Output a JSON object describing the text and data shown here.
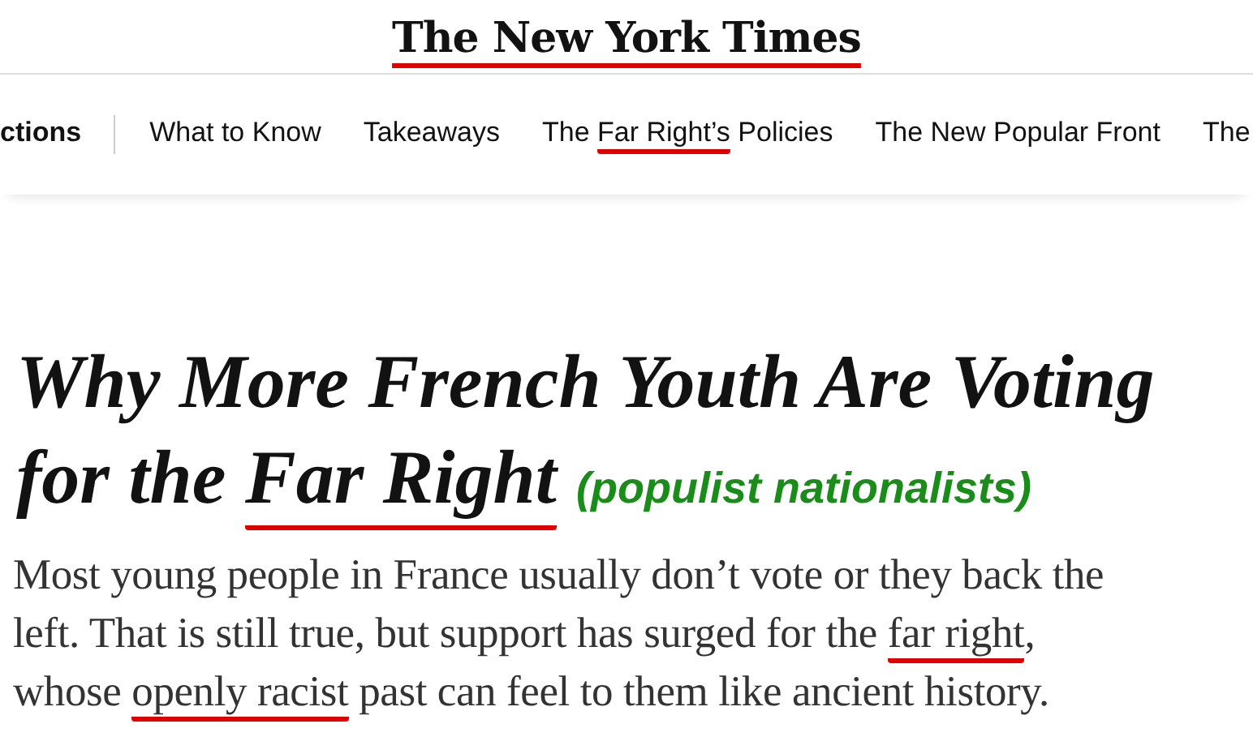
{
  "masthead": {
    "logo": "The New York Times",
    "marked": true
  },
  "nav": {
    "items": [
      {
        "segments": [
          {
            "text": "ctions",
            "marked": false
          }
        ],
        "selected": true
      },
      {
        "segments": [
          {
            "text": "What to Know",
            "marked": false
          }
        ],
        "selected": false
      },
      {
        "segments": [
          {
            "text": "Takeaways",
            "marked": false
          }
        ],
        "selected": false
      },
      {
        "segments": [
          {
            "text": "The ",
            "marked": false
          },
          {
            "text": "Far Right’s",
            "marked": true
          },
          {
            "text": " Policies",
            "marked": false
          }
        ],
        "selected": false
      },
      {
        "segments": [
          {
            "text": "The New Popular Front",
            "marked": false
          }
        ],
        "selected": false
      },
      {
        "segments": [
          {
            "text": "The",
            "marked": false
          }
        ],
        "selected": false
      }
    ]
  },
  "headline": {
    "lines": [
      [
        {
          "text": "Why More French Youth Are Voting",
          "marked": false
        }
      ],
      [
        {
          "text": "for the ",
          "marked": false
        },
        {
          "text": "Far Right",
          "marked": true
        }
      ]
    ],
    "annotation": "(populist nationalists)"
  },
  "summary": {
    "lines": [
      [
        {
          "text": "Most young people in France usually don’t vote or they back the",
          "marked": false
        }
      ],
      [
        {
          "text": "left. That is still true, but support has surged for the ",
          "marked": false
        },
        {
          "text": "far right",
          "marked": true
        },
        {
          "text": ",",
          "marked": false
        }
      ],
      [
        {
          "text": "whose ",
          "marked": false
        },
        {
          "text": "openly racist",
          "marked": true
        },
        {
          "text": " past can feel to them like ancient history.",
          "marked": false
        }
      ]
    ]
  }
}
